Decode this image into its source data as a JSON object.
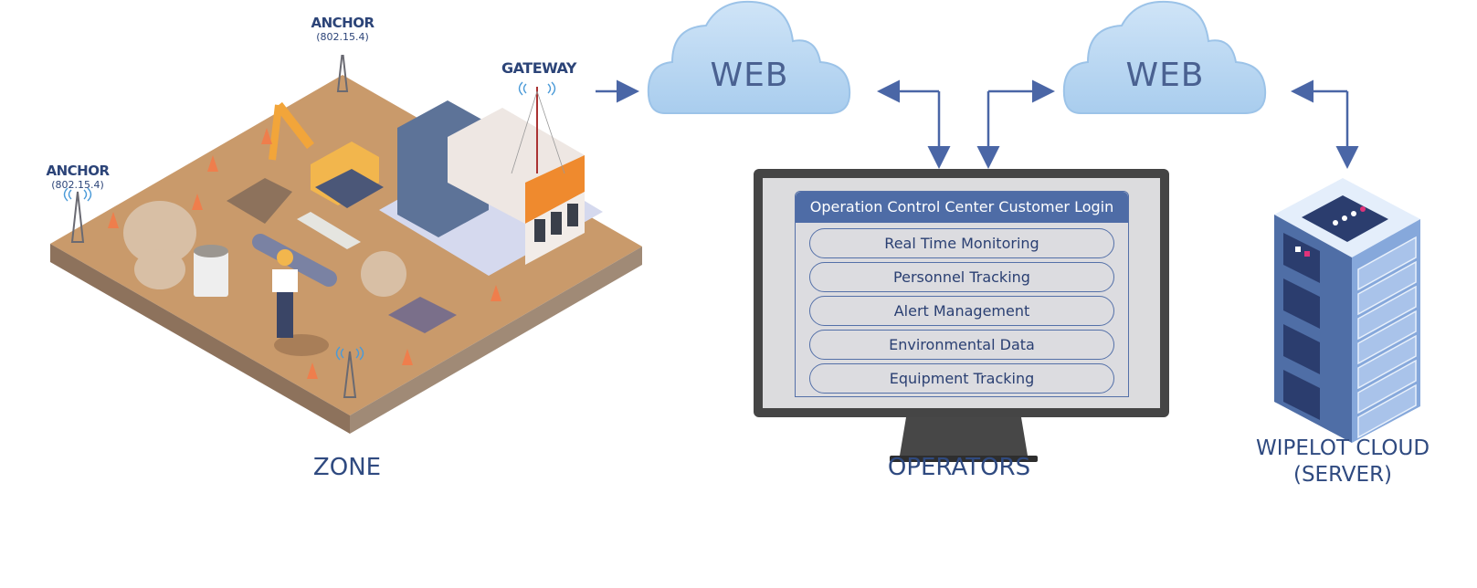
{
  "zone": {
    "label": "ZONE",
    "anchors": [
      {
        "title": "ANCHOR",
        "protocol": "(802.15.4)"
      },
      {
        "title": "ANCHOR",
        "protocol": "(802.15.4)"
      }
    ],
    "gateway_label": "GATEWAY"
  },
  "clouds": [
    {
      "label": "WEB"
    },
    {
      "label": "WEB"
    }
  ],
  "operators": {
    "label": "OPERATORS",
    "screen": {
      "header": "Operation Control Center Customer Login",
      "menu": [
        {
          "label": "Real Time Monitoring"
        },
        {
          "label": "Personnel Tracking"
        },
        {
          "label": "Alert Management"
        },
        {
          "label": "Environmental Data"
        },
        {
          "label": "Equipment Tracking"
        }
      ]
    }
  },
  "server": {
    "label_line1": "WIPELOT CLOUD",
    "label_line2": "(SERVER)"
  },
  "colors": {
    "arrow": "#4a66a6",
    "text": "#2c4478",
    "cloud": "#b7d6f2",
    "ground": "#c99a6b",
    "screen_header": "#4e6ca6"
  }
}
